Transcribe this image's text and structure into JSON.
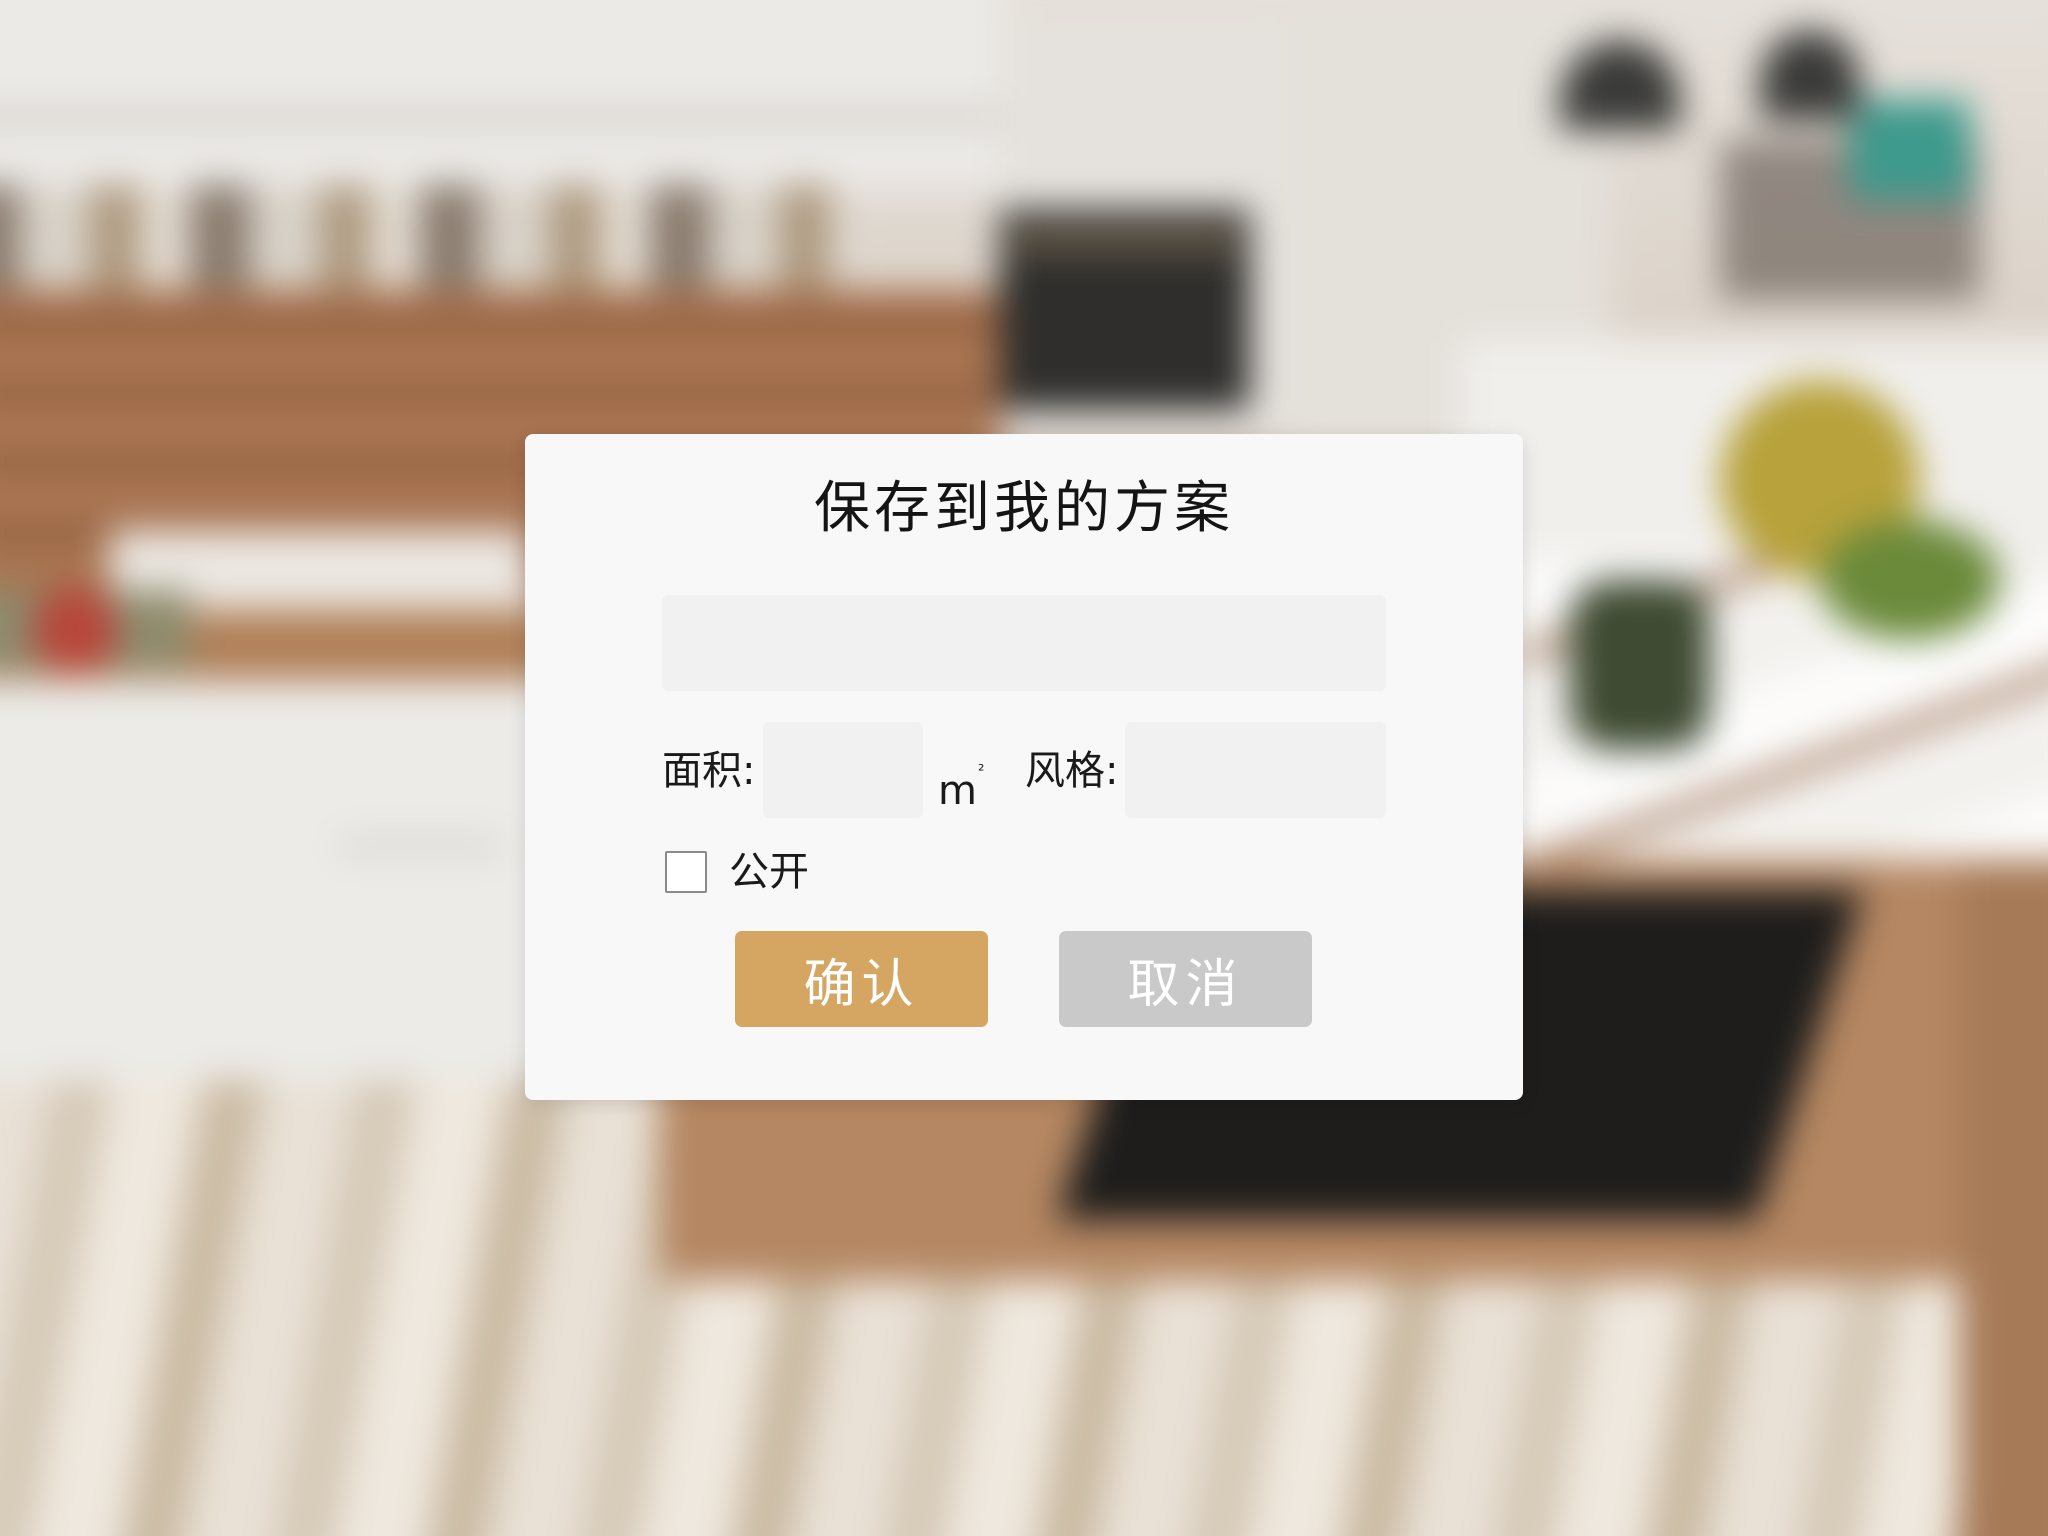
{
  "colors": {
    "dialog_background": "#f8f8f8",
    "input_background": "#f1f1f1",
    "confirm_button": "#d4a662",
    "cancel_button": "#c9c9c9",
    "text": "#141414"
  },
  "dialog": {
    "title": "保存到我的方案",
    "name_input": {
      "value": "",
      "placeholder": ""
    },
    "area": {
      "label": "面积:",
      "value": "",
      "unit": "m",
      "unit_superscript": "²"
    },
    "style": {
      "label": "风格:",
      "value": ""
    },
    "public": {
      "label": "公开",
      "checked": false
    },
    "buttons": {
      "confirm_label": "确认",
      "cancel_label": "取消"
    }
  }
}
